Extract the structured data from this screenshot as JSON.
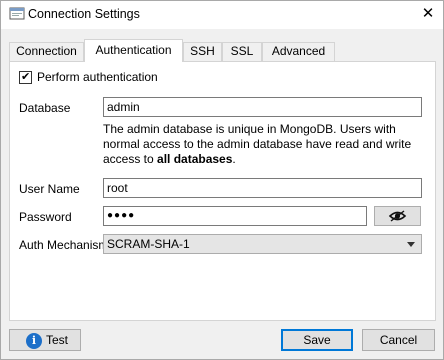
{
  "window": {
    "title": "Connection Settings",
    "close_glyph": "✕"
  },
  "tabs": [
    {
      "label": "Connection",
      "active": false
    },
    {
      "label": "Authentication",
      "active": true
    },
    {
      "label": "SSH",
      "active": false
    },
    {
      "label": "SSL",
      "active": false
    },
    {
      "label": "Advanced",
      "active": false
    }
  ],
  "auth": {
    "perform_label": "Perform authentication",
    "perform_checked": true,
    "database_label": "Database",
    "database_value": "admin",
    "note_prefix": "The admin database is unique in MongoDB. Users with normal access to the admin database have read and write access to ",
    "note_bold": "all databases",
    "note_suffix": ".",
    "username_label": "User Name",
    "username_value": "root",
    "password_label": "Password",
    "password_masked": "●●●●",
    "mechanism_label": "Auth Mechanism",
    "mechanism_value": "SCRAM-SHA-1"
  },
  "footer": {
    "test_label": "Test",
    "save_label": "Save",
    "cancel_label": "Cancel"
  },
  "icons": {
    "app": "connection-settings-icon",
    "eye": "eye-icon",
    "info": "info-icon"
  }
}
